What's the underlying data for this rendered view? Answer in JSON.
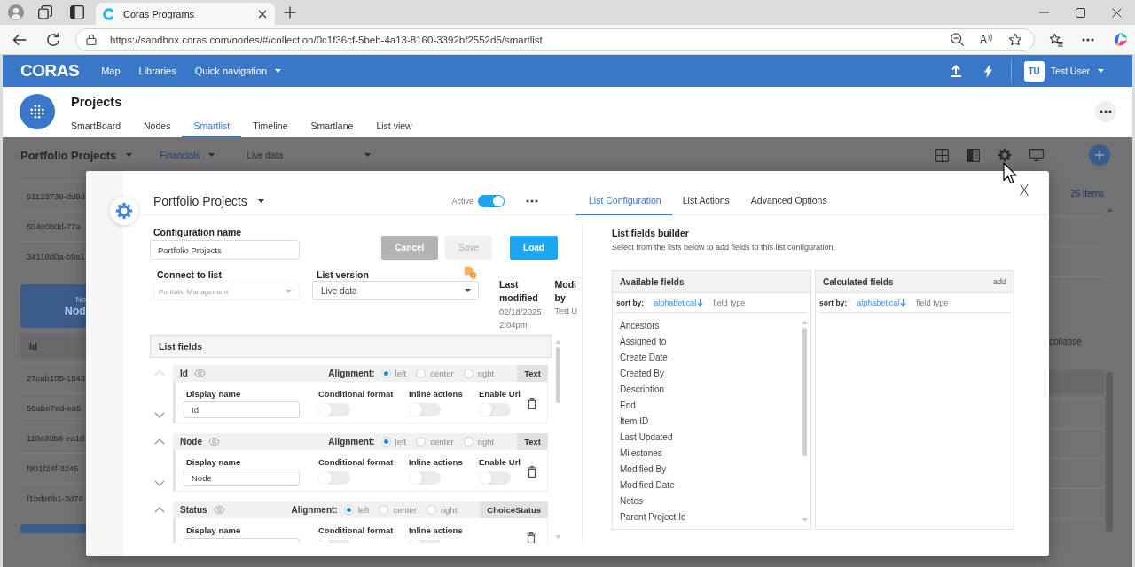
{
  "browser": {
    "tab_title": "Coras Programs",
    "url": "https://sandbox.coras.com/nodes/#/collection/0c1f36cf-5beb-4a13-8160-3392bf2552d5/smartlist",
    "read_aloud": "A"
  },
  "app_bar": {
    "logo": "CORAS",
    "nav": [
      {
        "label": "Map",
        "dropdown": false
      },
      {
        "label": "Libraries",
        "dropdown": false
      },
      {
        "label": "Quick navigation",
        "dropdown": true
      }
    ],
    "user": {
      "initials": "TU",
      "name": "Test User"
    }
  },
  "page_header": {
    "title": "Projects",
    "tabs": [
      {
        "label": "SmartBoard",
        "selected": false
      },
      {
        "label": "Nodes",
        "selected": false
      },
      {
        "label": "Smartlist",
        "selected": true
      },
      {
        "label": "Timeline",
        "selected": false
      },
      {
        "label": "Smartlane",
        "selected": false
      },
      {
        "label": "List view",
        "selected": false
      }
    ]
  },
  "background": {
    "view_title": "Portfolio Projects",
    "filter": "Financials",
    "version": "Live data",
    "item_count": "26 items",
    "collapse": "collapse",
    "top_rows": [
      "51123739-dd9d",
      "504c0b0d-77a",
      "34118d0a-b9a1"
    ],
    "card": {
      "line_1": "No",
      "line_2": "Nod"
    },
    "id_header": "Id",
    "rows": [
      "27cab105-1543",
      "50abe7ed-ea5",
      "110c39b8-ea1d",
      "f901f24f-3245",
      "f1bde8b1-3d76"
    ]
  },
  "dialog": {
    "title": "Portfolio Projects",
    "active": {
      "label": "Active",
      "on": true
    },
    "tabs": [
      {
        "label": "List Configuration",
        "selected": true
      },
      {
        "label": "List Actions",
        "selected": false
      },
      {
        "label": "Advanced Options",
        "selected": false
      }
    ],
    "close": "X",
    "config_name": {
      "label": "Configuration name",
      "value": "Portfolio Projects"
    },
    "buttons": [
      {
        "label": "Cancel",
        "kind": "cancel",
        "disabled": true
      },
      {
        "label": "Save",
        "kind": "save",
        "disabled": true
      },
      {
        "label": "Load",
        "kind": "primary",
        "disabled": false
      }
    ],
    "connect_to_list": {
      "label": "Connect to list",
      "value": "Portfolio Management",
      "disabled": true
    },
    "list_version": {
      "label": "List version",
      "value": "Live data",
      "disabled": false
    },
    "last_modified": {
      "label": "Last modified",
      "date": "02/18/2025",
      "time": "2:04pm"
    },
    "modified_by": {
      "label": "Modi by",
      "value": "Test U"
    },
    "list_fields": {
      "title": "List fields",
      "fields": [
        {
          "name": "Id",
          "up_disabled": true,
          "alignment_label": "Alignment:",
          "alignments": [
            {
              "label": "left",
              "selected": true
            },
            {
              "label": "center",
              "selected": false
            },
            {
              "label": "right",
              "selected": false
            }
          ],
          "type": "Text",
          "display_name_label": "Display name",
          "display_name": "Id",
          "options": [
            {
              "label": "Conditional format",
              "on": false
            },
            {
              "label": "Inline actions",
              "on": false
            },
            {
              "label": "Enable Url",
              "on": false
            }
          ]
        },
        {
          "name": "Node",
          "up_disabled": false,
          "alignment_label": "Alignment:",
          "alignments": [
            {
              "label": "left",
              "selected": true
            },
            {
              "label": "center",
              "selected": false
            },
            {
              "label": "right",
              "selected": false
            }
          ],
          "type": "Text",
          "display_name_label": "Display name",
          "display_name": "Node",
          "options": [
            {
              "label": "Conditional format",
              "on": false
            },
            {
              "label": "Inline actions",
              "on": false
            },
            {
              "label": "Enable Url",
              "on": false
            }
          ]
        },
        {
          "name": "Status",
          "up_disabled": false,
          "alignment_label": "Alignment:",
          "alignments": [
            {
              "label": "left",
              "selected": true
            },
            {
              "label": "center",
              "selected": false
            },
            {
              "label": "right",
              "selected": false
            }
          ],
          "type": "ChoiceStatus",
          "display_name_label": "Display name",
          "options": [
            {
              "label": "Conditional format",
              "on": false
            },
            {
              "label": "Inline actions",
              "on": false
            }
          ]
        }
      ]
    },
    "builder": {
      "title": "List fields builder",
      "subtitle": "Select from the lists below to add fields to this list configuration.",
      "panels": [
        {
          "title": "Available fields",
          "sort_label": "sort by:",
          "sort_options": [
            {
              "label": "alphabetical",
              "selected": true
            },
            {
              "label": "field type",
              "selected": false
            }
          ],
          "items": [
            "Ancestors",
            "Assigned to",
            "Create Date",
            "Created By",
            "Description",
            "End",
            "Item ID",
            "Last Updated",
            "Milestones",
            "Modified By",
            "Modified Date",
            "Notes",
            "Parent Project Id"
          ]
        },
        {
          "title": "Calculated fields",
          "action": "add",
          "sort_label": "sort by:",
          "sort_options": [
            {
              "label": "alphabetical",
              "selected": true
            },
            {
              "label": "field type",
              "selected": false
            }
          ]
        }
      ]
    }
  }
}
